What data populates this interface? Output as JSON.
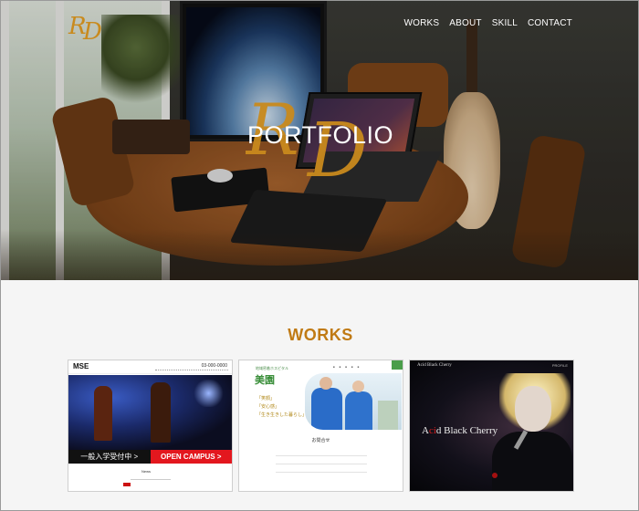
{
  "nav": {
    "items": [
      "WORKS",
      "ABOUT",
      "SKILL",
      "CONTACT"
    ],
    "active": "SKILL"
  },
  "logo": {
    "text": "RD",
    "color": "#c98a1d"
  },
  "hero": {
    "title": "PORTFOLIO"
  },
  "works": {
    "title": "WORKS",
    "title_color": "#c07a14",
    "cards": [
      {
        "site_name": "MSE",
        "phone": "03-000-0000",
        "left_button": "一般入学受付中 >",
        "right_button": "OPEN CAMPUS >",
        "news_heading": "News"
      },
      {
        "brand_small": "地域密着ホスピタル",
        "brand_name": "美園",
        "lines": [
          "「笑顔」",
          "「安心感」",
          "「生き生きした暮らし」"
        ],
        "form_heading": "お問合せ"
      },
      {
        "site_name": "Acid Black Cherry",
        "menu": "PROFILE",
        "title_pre": "A",
        "title_accent": "ci",
        "title_post": "d Black Cherry"
      }
    ]
  }
}
